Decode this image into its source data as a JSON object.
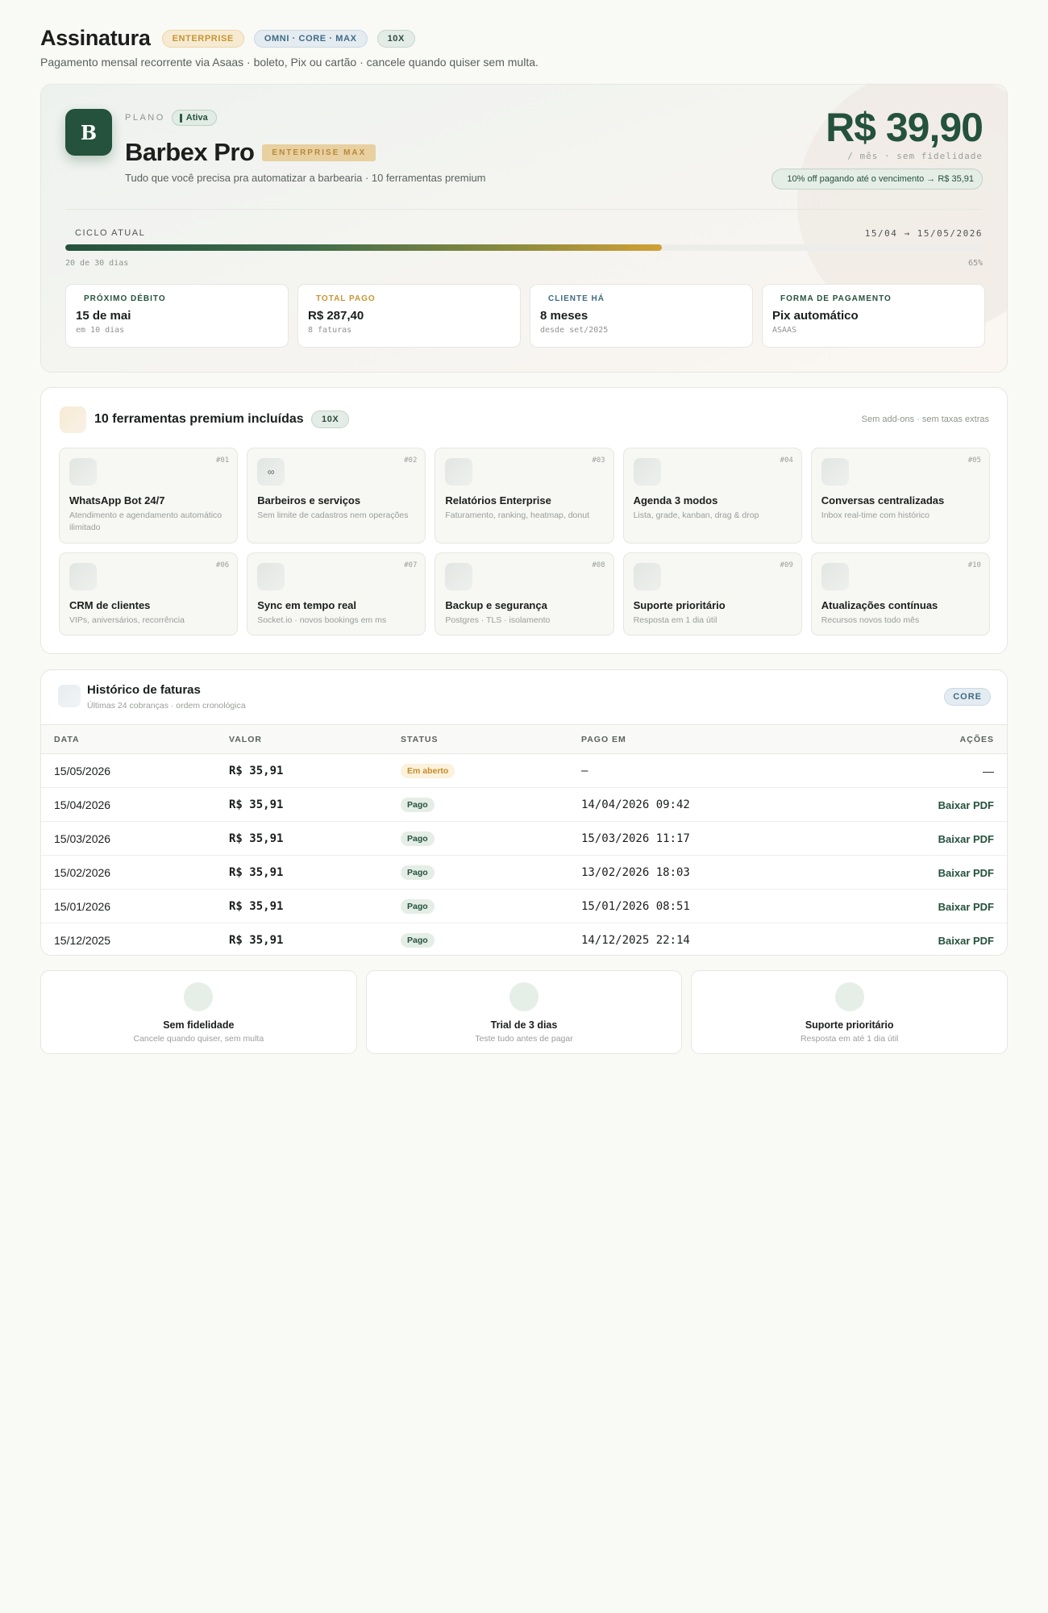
{
  "header": {
    "title": "Assinatura",
    "badges": [
      "ENTERPRISE",
      "OMNI · CORE · MAX",
      "10X"
    ],
    "subtitle": "Pagamento mensal recorrente via Asaas · boleto, Pix ou cartão · cancele quando quiser sem multa."
  },
  "plan": {
    "logo_letter": "B",
    "label": "PLANO",
    "status": "Ativa",
    "name": "Barbex Pro",
    "tier": "ENTERPRISE MAX",
    "description": "Tudo que você precisa pra automatizar a barbearia · 10 ferramentas premium",
    "price": "R$ 39,90",
    "price_note": "/ mês · sem fidelidade",
    "discount": "10% off pagando até o vencimento → R$ 35,91"
  },
  "cycle": {
    "label": "CICLO ATUAL",
    "dates": "15/04 → 15/05/2026",
    "days_text": "20 de 30 dias",
    "percent_text": "65%",
    "progress": 0.65
  },
  "stats": [
    {
      "label": "PRÓXIMO DÉBITO",
      "value": "15 de mai",
      "sub": "em 10 dias",
      "color": "#24523c"
    },
    {
      "label": "TOTAL PAGO",
      "value": "R$ 287,40",
      "sub": "8 faturas",
      "color": "#c79433"
    },
    {
      "label": "CLIENTE HÁ",
      "value": "8 meses",
      "sub": "desde set/2025",
      "color": "#3f6a86"
    },
    {
      "label": "FORMA DE PAGAMENTO",
      "value": "Pix automático",
      "sub": "ASAAS",
      "color": "#24523c"
    }
  ],
  "tools": {
    "title": "10 ferramentas premium incluídas",
    "badge": "10X",
    "note": "Sem add-ons · sem taxas extras",
    "items": [
      {
        "num": "#01",
        "name": "WhatsApp Bot 24/7",
        "desc": "Atendimento e agendamento automático ilimitado",
        "icon": ""
      },
      {
        "num": "#02",
        "name": "Barbeiros e serviços",
        "desc": "Sem limite de cadastros nem operações",
        "icon": "∞"
      },
      {
        "num": "#03",
        "name": "Relatórios Enterprise",
        "desc": "Faturamento, ranking, heatmap, donut",
        "icon": ""
      },
      {
        "num": "#04",
        "name": "Agenda 3 modos",
        "desc": "Lista, grade, kanban, drag & drop",
        "icon": ""
      },
      {
        "num": "#05",
        "name": "Conversas centralizadas",
        "desc": "Inbox real-time com histórico",
        "icon": ""
      },
      {
        "num": "#06",
        "name": "CRM de clientes",
        "desc": "VIPs, aniversários, recorrência",
        "icon": ""
      },
      {
        "num": "#07",
        "name": "Sync em tempo real",
        "desc": "Socket.io · novos bookings em ms",
        "icon": ""
      },
      {
        "num": "#08",
        "name": "Backup e segurança",
        "desc": "Postgres · TLS · isolamento",
        "icon": ""
      },
      {
        "num": "#09",
        "name": "Suporte prioritário",
        "desc": "Resposta em 1 dia útil",
        "icon": ""
      },
      {
        "num": "#10",
        "name": "Atualizações contínuas",
        "desc": "Recursos novos todo mês",
        "icon": ""
      }
    ]
  },
  "invoices": {
    "title": "Histórico de faturas",
    "subtitle": "Últimas 24 cobranças · ordem cronológica",
    "badge": "CORE",
    "columns": [
      "DATA",
      "VALOR",
      "STATUS",
      "PAGO EM",
      "AÇÕES"
    ],
    "rows": [
      {
        "date": "15/05/2026",
        "amount": "R$ 35,91",
        "status": "Em aberto",
        "status_type": "open",
        "paid_at": "–",
        "action": "—"
      },
      {
        "date": "15/04/2026",
        "amount": "R$ 35,91",
        "status": "Pago",
        "status_type": "paid",
        "paid_at": "14/04/2026 09:42",
        "action": "Baixar PDF"
      },
      {
        "date": "15/03/2026",
        "amount": "R$ 35,91",
        "status": "Pago",
        "status_type": "paid",
        "paid_at": "15/03/2026 11:17",
        "action": "Baixar PDF"
      },
      {
        "date": "15/02/2026",
        "amount": "R$ 35,91",
        "status": "Pago",
        "status_type": "paid",
        "paid_at": "13/02/2026 18:03",
        "action": "Baixar PDF"
      },
      {
        "date": "15/01/2026",
        "amount": "R$ 35,91",
        "status": "Pago",
        "status_type": "paid",
        "paid_at": "15/01/2026 08:51",
        "action": "Baixar PDF"
      },
      {
        "date": "15/12/2025",
        "amount": "R$ 35,91",
        "status": "Pago",
        "status_type": "paid",
        "paid_at": "14/12/2025 22:14",
        "action": "Baixar PDF"
      }
    ]
  },
  "features": [
    {
      "title": "Sem fidelidade",
      "sub": "Cancele quando quiser, sem multa"
    },
    {
      "title": "Trial de 3 dias",
      "sub": "Teste tudo antes de pagar"
    },
    {
      "title": "Suporte prioritário",
      "sub": "Resposta em até 1 dia útil"
    }
  ]
}
